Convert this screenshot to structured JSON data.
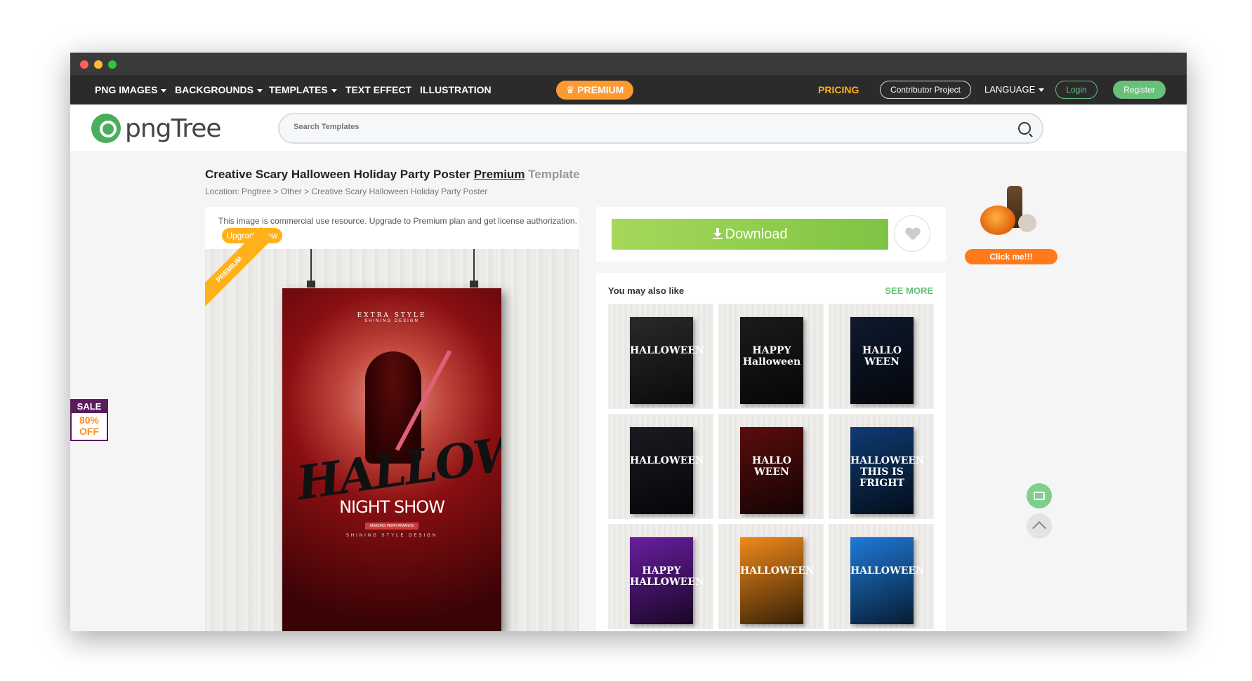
{
  "nav": {
    "items": [
      {
        "label": "PNG IMAGES",
        "dropdown": true
      },
      {
        "label": "BACKGROUNDS",
        "dropdown": true
      },
      {
        "label": "TEMPLATES",
        "dropdown": true
      },
      {
        "label": "TEXT EFFECT",
        "dropdown": false
      },
      {
        "label": "ILLUSTRATION",
        "dropdown": false
      }
    ],
    "premium": "PREMIUM",
    "pricing": "PRICING",
    "contributor": "Contributor Project",
    "language": "LANGUAGE",
    "login": "Login",
    "register": "Register"
  },
  "logo": {
    "text": "pngTree"
  },
  "search": {
    "placeholder": "Search Templates"
  },
  "page": {
    "title_main": "Creative Scary Halloween Holiday Party Poster",
    "title_premium": "Premium",
    "title_template": "Template",
    "breadcrumb": "Location: Pngtree > Other > Creative Scary Halloween Holiday Party Poster"
  },
  "notice": {
    "text": "This image is commercial use resource. Upgrade to Premium plan and get license authorization.",
    "upgrade_label": "Upgrade Now"
  },
  "preview": {
    "ribbon": "PREMIUM",
    "poster_top": "EXTRA STYLE",
    "poster_sub": "SHINING DESIGN",
    "poster_title": "HALLOWEEN",
    "poster_night": "NIGHT SHOW",
    "poster_perf": "AMAZING PERFORMANCE",
    "poster_design": "SHINING STYLE DESIGN"
  },
  "download": {
    "label": "Download"
  },
  "recommend": {
    "title": "You may also like",
    "see_more": "SEE MORE",
    "thumbs": [
      {
        "caption": "HALLOWEEN",
        "color": "#2a2a2a"
      },
      {
        "caption": "HAPPY Halloween",
        "color": "#1b1b1b"
      },
      {
        "caption": "HALLO WEEN",
        "color": "#0f1a2e"
      },
      {
        "caption": "HALLOWEEN",
        "color": "#1a1a22"
      },
      {
        "caption": "HALLO WEEN",
        "color": "#5a0d0d"
      },
      {
        "caption": "HALLOWEEN THIS IS FRIGHT",
        "color": "#0f3b73"
      },
      {
        "caption": "HAPPY HALLOWEEN",
        "color": "#6a1ea0"
      },
      {
        "caption": "HALLOWEEN",
        "color": "#f08a1a"
      },
      {
        "caption": "HALLOWEEN",
        "color": "#1f7ad8"
      }
    ]
  },
  "sale": {
    "top": "SALE",
    "pct": "80%",
    "off": "OFF"
  },
  "promo": {
    "click_label": "Click me!!!"
  },
  "colors": {
    "accent_green": "#69c079",
    "premium_orange": "#ff9a2e",
    "pricing_yellow": "#ffb11b"
  }
}
